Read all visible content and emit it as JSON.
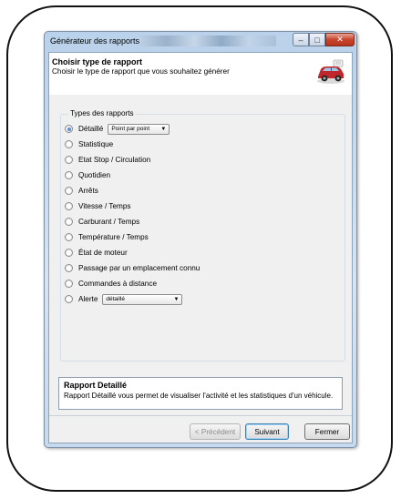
{
  "window": {
    "title": "Générateur des rapports",
    "minimize_icon": "minimize-icon",
    "maximize_icon": "maximize-icon",
    "close_icon": "close-icon"
  },
  "header": {
    "title": "Choisir type de rapport",
    "subtitle": "Choisir le type de rapport que vous souhaitez  générer",
    "icon": "car-icon"
  },
  "group": {
    "label": "Types des rapports",
    "options": [
      {
        "label": "Détaillé",
        "checked": true,
        "dropdown": "Point par point"
      },
      {
        "label": "Statistique",
        "checked": false
      },
      {
        "label": "Etat Stop / Circulation",
        "checked": false
      },
      {
        "label": "Quotidien",
        "checked": false
      },
      {
        "label": "Arrêts",
        "checked": false
      },
      {
        "label": "Vitesse / Temps",
        "checked": false
      },
      {
        "label": "Carburant / Temps",
        "checked": false
      },
      {
        "label": "Température / Temps",
        "checked": false
      },
      {
        "label": "État de moteur",
        "checked": false
      },
      {
        "label": "Passage par un emplacement connu",
        "checked": false
      },
      {
        "label": "Commandes à distance",
        "checked": false
      },
      {
        "label": "Alerte",
        "checked": false,
        "dropdown": "détaillé"
      }
    ]
  },
  "info": {
    "title": "Rapport Detaillé",
    "text": "Rapport Détaillé vous permet de visualiser l'activité et les statistiques d'un véhicule."
  },
  "footer": {
    "prev_label": "< Précédent",
    "next_label": "Suivant",
    "close_label": "Fermer"
  },
  "colors": {
    "titlebar": "#b9d1ea",
    "close_button": "#c8452c",
    "radio_selected": "#1d5fb0"
  }
}
